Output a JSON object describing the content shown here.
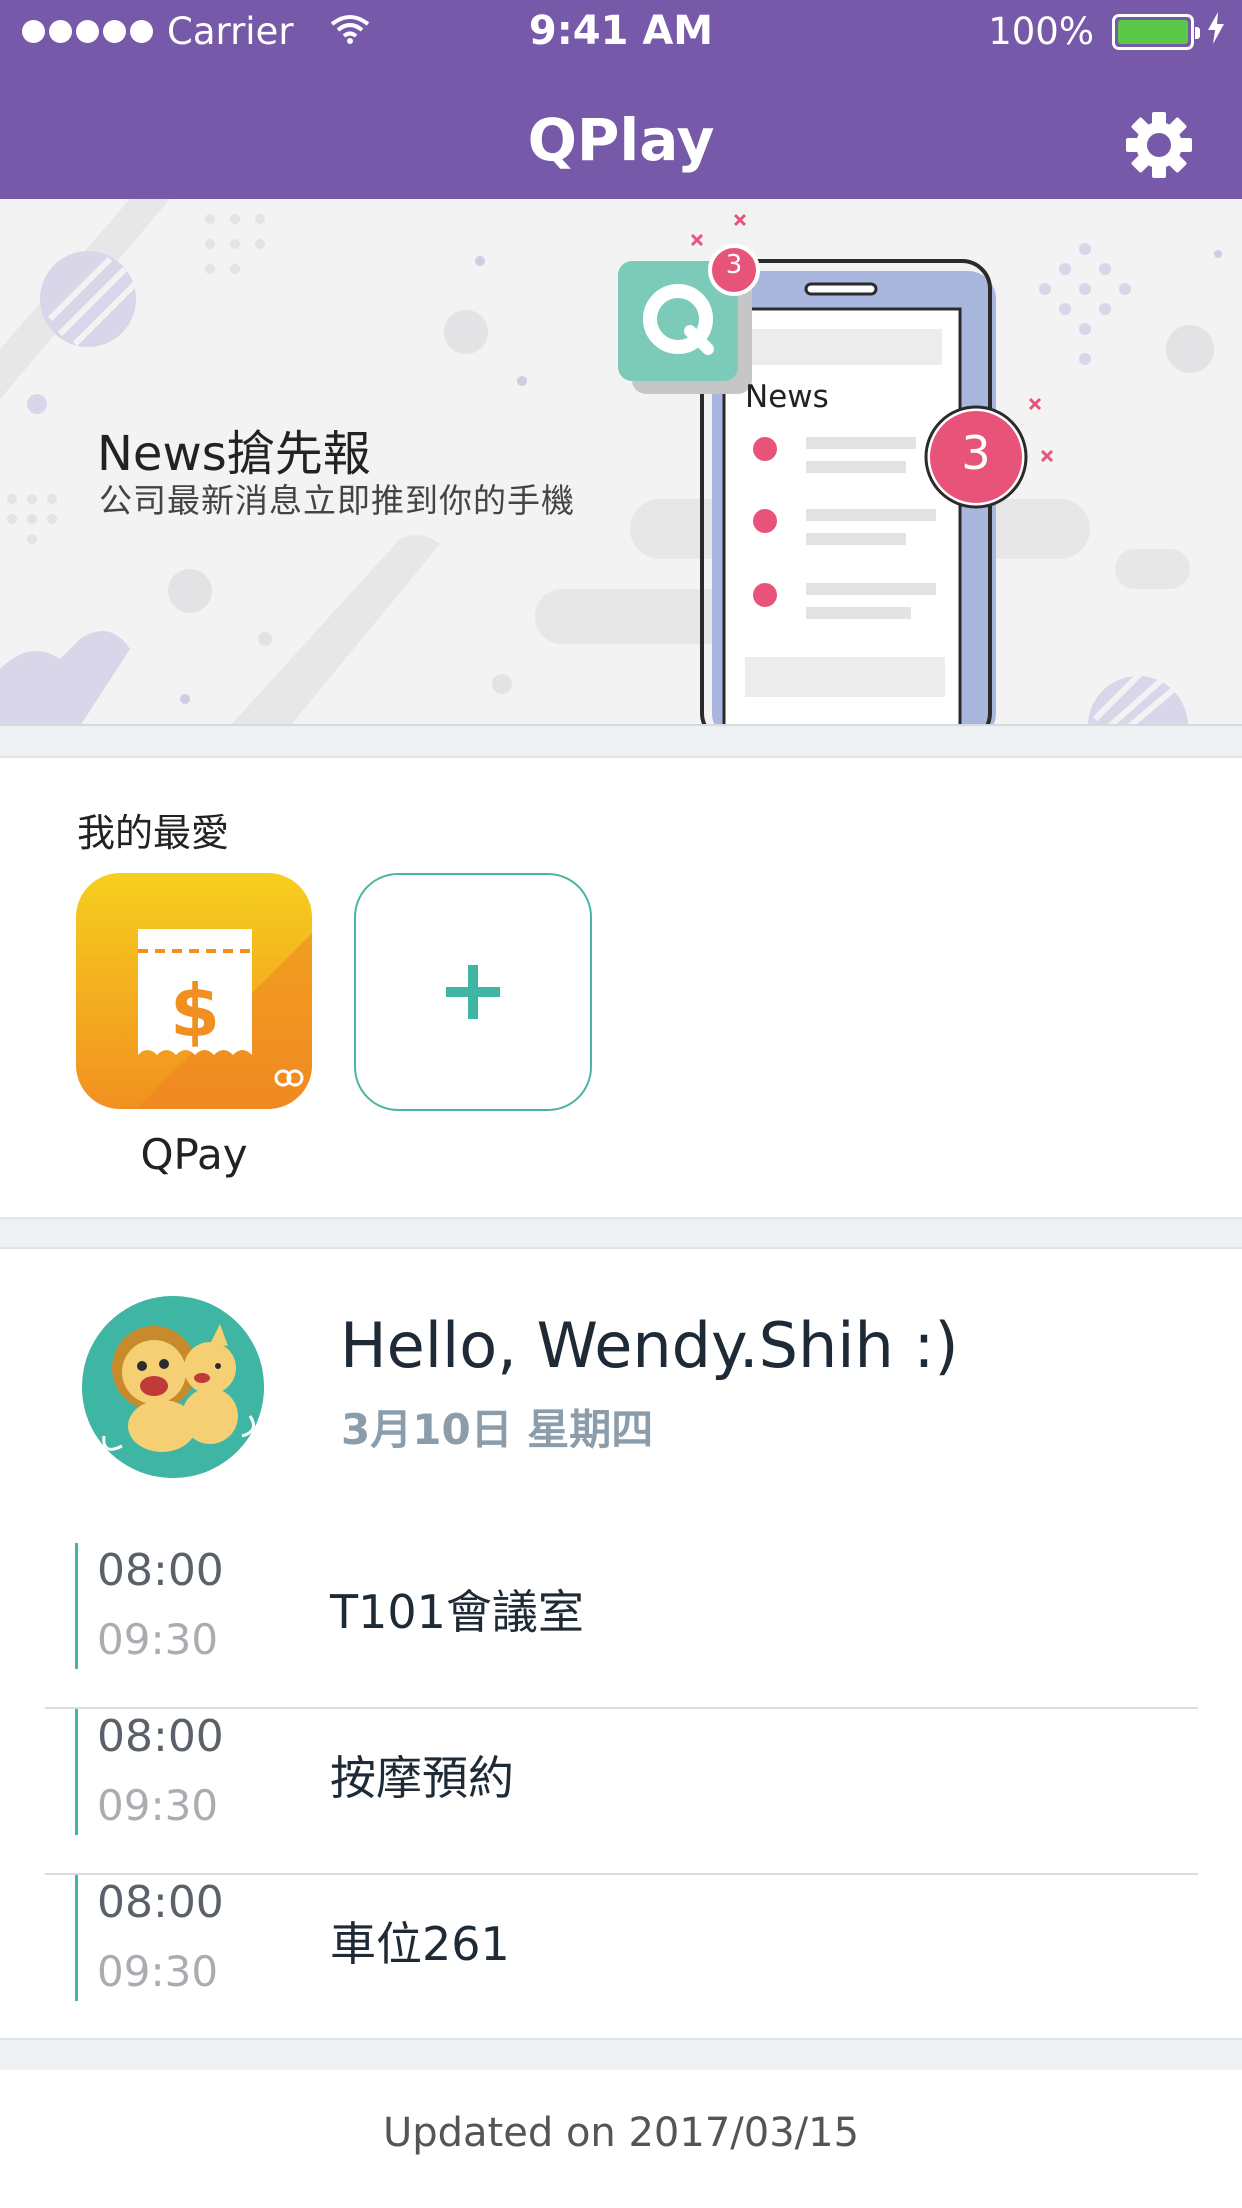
{
  "status_bar": {
    "carrier": "Carrier",
    "time": "9:41 AM",
    "battery": "100%"
  },
  "nav": {
    "title": "QPlay",
    "settings_icon": "gear-icon"
  },
  "banner": {
    "title": "News搶先報",
    "subtitle": "公司最新消息立即推到你的手機",
    "phone_label": "News",
    "badge_small": "3",
    "badge_large": "3"
  },
  "favorites": {
    "title": "我的最愛",
    "apps": [
      {
        "label": "QPay",
        "icon": "receipt-dollar-icon"
      }
    ],
    "add_icon": "plus-icon"
  },
  "agenda": {
    "greeting": "Hello, Wendy.Shih :)",
    "date": "3月10日 星期四",
    "events": [
      {
        "start": "08:00",
        "end": "09:30",
        "title": "T101會議室"
      },
      {
        "start": "08:00",
        "end": "09:30",
        "title": "按摩預約"
      },
      {
        "start": "08:00",
        "end": "09:30",
        "title": "車位261"
      }
    ]
  },
  "footer": {
    "updated": "Updated on 2017/03/15"
  },
  "colors": {
    "brand": "#7659a8",
    "accent": "#3fb6a3",
    "badge": "#e8537a",
    "qpay_orange": "#f5a623"
  }
}
